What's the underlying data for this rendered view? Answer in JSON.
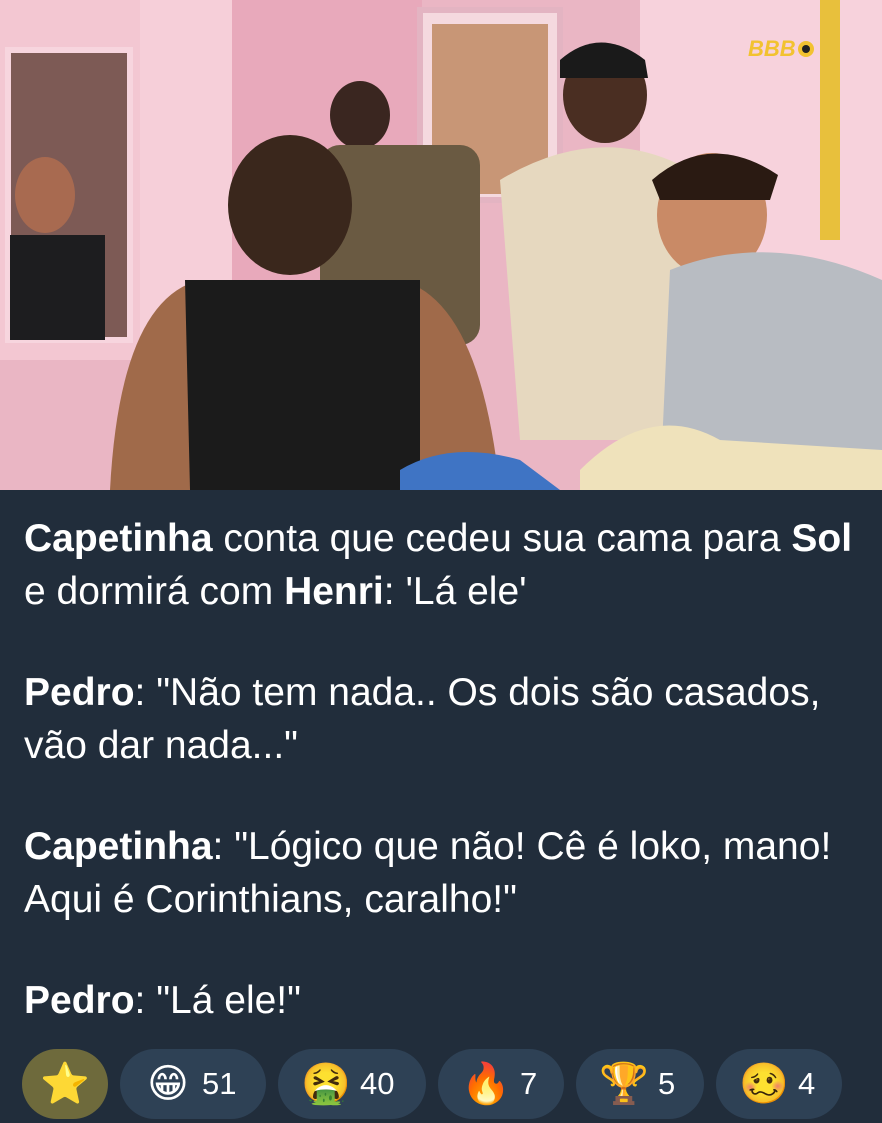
{
  "post": {
    "image": {
      "alt": "Photo",
      "watermark": "BBB"
    },
    "paragraphs": [
      {
        "segments": [
          {
            "bold": true,
            "text": "Capetinha"
          },
          {
            "bold": false,
            "text": " conta que cedeu sua cama para "
          },
          {
            "bold": true,
            "text": "Sol"
          },
          {
            "bold": false,
            "text": " e dormirá com "
          },
          {
            "bold": true,
            "text": "Henri"
          },
          {
            "bold": false,
            "text": ": 'Lá ele'"
          }
        ]
      },
      {
        "segments": [
          {
            "bold": true,
            "text": "Pedro"
          },
          {
            "bold": false,
            "text": ": \"Não tem nada.. Os dois são casados, vão dar nada...\""
          }
        ]
      },
      {
        "segments": [
          {
            "bold": true,
            "text": "Capetinha"
          },
          {
            "bold": false,
            "text": ": \"Lógico que não! Cê é loko, mano! Aqui é Corinthians, caralho!\""
          }
        ]
      },
      {
        "segments": [
          {
            "bold": true,
            "text": "Pedro"
          },
          {
            "bold": false,
            "text": ": \"Lá ele!\""
          }
        ]
      }
    ]
  },
  "reactions": {
    "star": {
      "emoji": "⭐",
      "icon": "star-icon"
    },
    "items": [
      {
        "emoji": "😁",
        "icon": "grinning-face-icon",
        "count": "51"
      },
      {
        "emoji": "🤮",
        "icon": "vomiting-face-icon",
        "count": "40"
      },
      {
        "emoji": "🔥",
        "icon": "fire-icon",
        "count": "7"
      },
      {
        "emoji": "🏆",
        "icon": "trophy-icon",
        "count": "5"
      },
      {
        "emoji": "🥴",
        "icon": "woozy-face-icon",
        "count": "4"
      }
    ]
  },
  "colors": {
    "background": "#212d3b",
    "reaction_bg": "#2e4155",
    "star_bg": "#6e6a3c",
    "watermark": "#f2c230"
  }
}
